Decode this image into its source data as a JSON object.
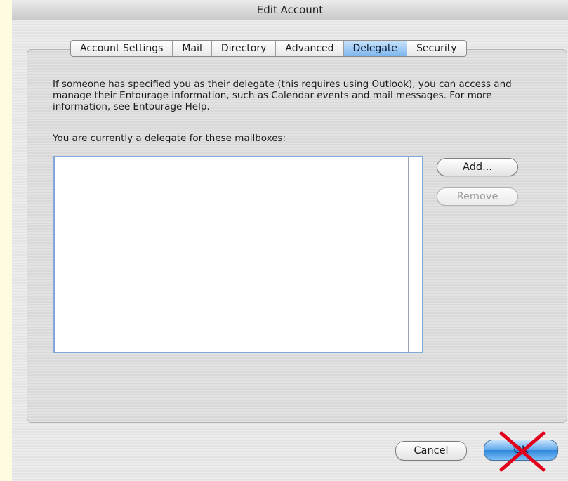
{
  "window": {
    "title": "Edit Account"
  },
  "tabs": [
    {
      "label": "Account Settings",
      "selected": false
    },
    {
      "label": "Mail",
      "selected": false
    },
    {
      "label": "Directory",
      "selected": false
    },
    {
      "label": "Advanced",
      "selected": false
    },
    {
      "label": "Delegate",
      "selected": true
    },
    {
      "label": "Security",
      "selected": false
    }
  ],
  "delegate": {
    "intro_text": "If someone has specified you as their delegate (this requires using Outlook),  you can access and manage their Entourage information, such as Calendar events and mail messages. For more information, see Entourage Help.",
    "list_label": "You are currently a delegate for these mailboxes:",
    "mailboxes": [],
    "add_label": "Add...",
    "remove_label": "Remove",
    "remove_enabled": false
  },
  "footer": {
    "cancel_label": "Cancel",
    "ok_label": "OK",
    "ok_crossed_out": true
  },
  "colors": {
    "selected_tab": "#7eb6ee",
    "list_border": "#7fa8d9",
    "default_button": "#2f86dc",
    "cross_mark": "#e3001b",
    "page_background": "#fffbe0"
  }
}
